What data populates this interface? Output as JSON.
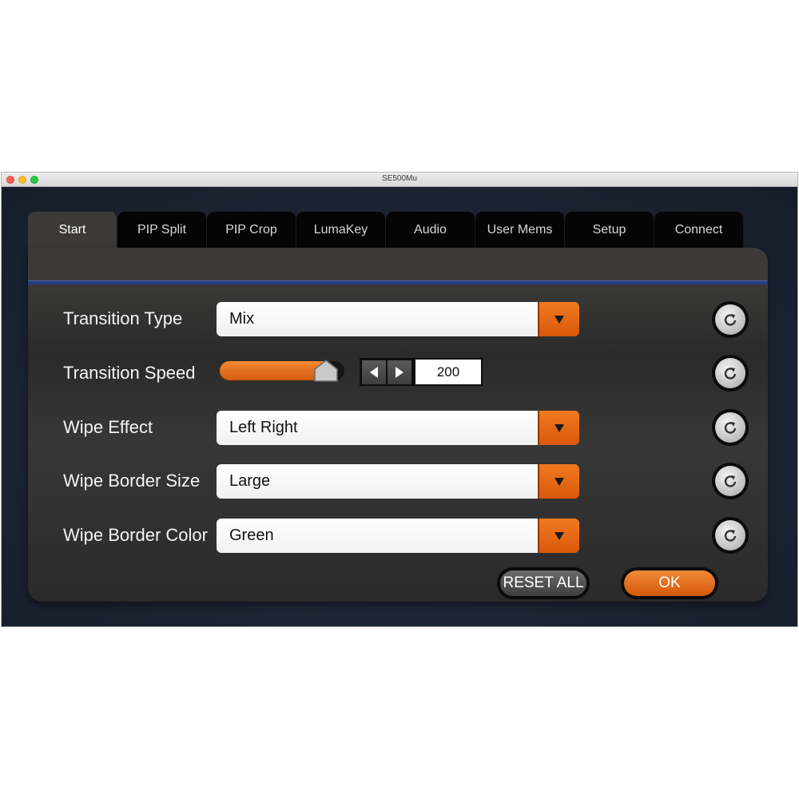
{
  "window": {
    "title": "SE500Mu"
  },
  "tabs": [
    {
      "label": "Start",
      "active": true
    },
    {
      "label": "PIP Split",
      "active": false
    },
    {
      "label": "PIP Crop",
      "active": false
    },
    {
      "label": "LumaKey",
      "active": false
    },
    {
      "label": "Audio",
      "active": false
    },
    {
      "label": "User Mems",
      "active": false
    },
    {
      "label": "Setup",
      "active": false
    },
    {
      "label": "Connect",
      "active": false
    }
  ],
  "settings": {
    "transition_type": {
      "label": "Transition Type",
      "value": "Mix"
    },
    "transition_speed": {
      "label": "Transition Speed",
      "value": "200",
      "slider_fraction": 0.85
    },
    "wipe_effect": {
      "label": "Wipe Effect",
      "value": "Left Right"
    },
    "wipe_border_size": {
      "label": "Wipe Border Size",
      "value": "Large"
    },
    "wipe_border_color": {
      "label": "Wipe Border Color",
      "value": "Green"
    }
  },
  "buttons": {
    "reset_all": "RESET ALL",
    "ok": "OK"
  },
  "icons": {
    "dropdown": "chevron-down-icon",
    "reset": "refresh-icon",
    "step_left": "arrow-left-icon",
    "step_right": "arrow-right-icon"
  },
  "colors": {
    "accent": "#e56a14",
    "panel": "#2f2f2f",
    "separator": "#253d86"
  }
}
